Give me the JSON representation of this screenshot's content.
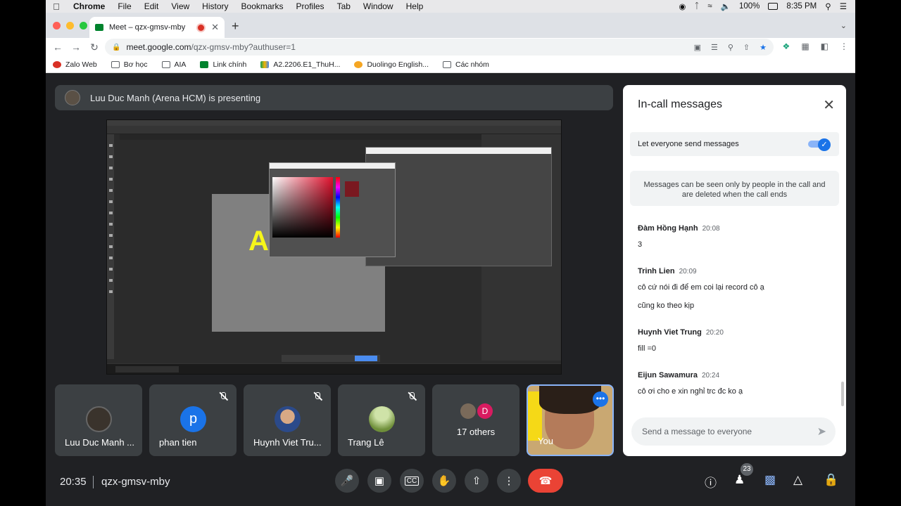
{
  "menubar": {
    "app": "Chrome",
    "items": [
      "File",
      "Edit",
      "View",
      "History",
      "Bookmarks",
      "Profiles",
      "Tab",
      "Window",
      "Help"
    ],
    "battery": "100%",
    "clock": "8:35 PM"
  },
  "browser": {
    "tab_title": "Meet – qzx-gmsv-mby",
    "url_host": "meet.google.com",
    "url_path": "/qzx-gmsv-mby?authuser=1",
    "bookmarks": [
      "Zalo Web",
      "Bơ học",
      "AIA",
      "Link chính",
      "A2.2206.E1_ThuH...",
      "Duolingo English...",
      "Các nhóm"
    ]
  },
  "meet": {
    "presenter_banner": "Luu Duc Manh (Arena HCM) is presenting",
    "tiles": [
      {
        "name": "Luu Duc Manh ...",
        "muted": false
      },
      {
        "name": "phan tien",
        "initial": "p",
        "muted": true
      },
      {
        "name": "Huynh Viet Tru...",
        "muted": true
      },
      {
        "name": "Trang Lê",
        "muted": true
      },
      {
        "others_label": "17 others",
        "initial": "D"
      },
      {
        "name": "You"
      }
    ],
    "time": "20:35",
    "meeting_code": "qzx-gmsv-mby",
    "people_count": "23",
    "colors": {
      "accent": "#1a73e8",
      "end_call": "#ea4335",
      "background": "#202124"
    }
  },
  "panel": {
    "title": "In-call messages",
    "toggle_label": "Let everyone send messages",
    "toggle_on": true,
    "info": "Messages can be seen only by people in the call and are deleted when the call ends",
    "messages": [
      {
        "sender": "Đàm Hồng Hạnh",
        "time": "20:08",
        "lines": [
          "3"
        ]
      },
      {
        "sender": "Trinh Lien",
        "time": "20:09",
        "lines": [
          "cô cứ nói đi để em coi lại record cô ạ",
          "cũng ko theo kịp"
        ]
      },
      {
        "sender": "Huynh Viet Trung",
        "time": "20:20",
        "lines": [
          "fill =0"
        ]
      },
      {
        "sender": "Eijun Sawamura",
        "time": "20:24",
        "lines": [
          "cô ơi cho e xin nghỉ trc đc ko ạ"
        ]
      }
    ],
    "compose_placeholder": "Send a message to everyone"
  }
}
